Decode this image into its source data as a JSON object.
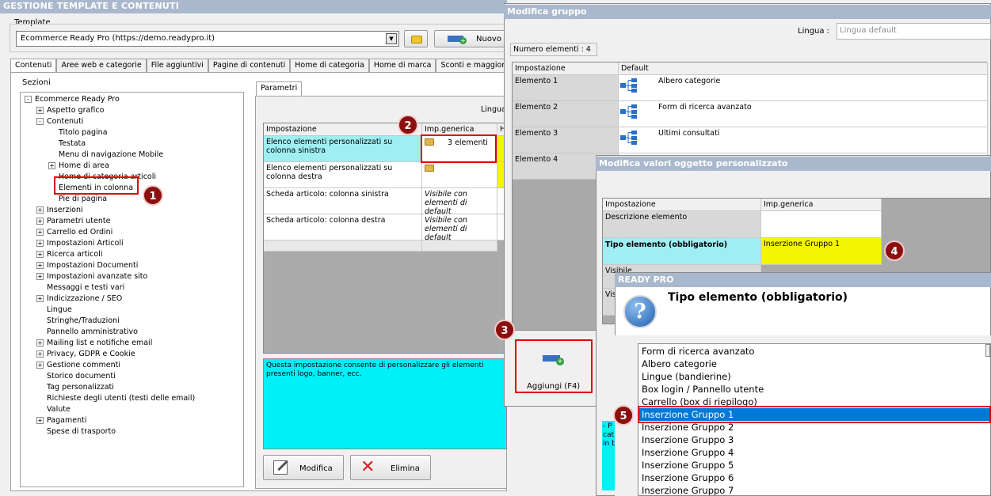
{
  "main": {
    "title": "GESTIONE TEMPLATE E CONTENUTI",
    "template_label": "Template",
    "template_value": "Ecommerce Ready Pro (https://demo.readypro.it)",
    "nuovo_label": "Nuovo",
    "tabs": [
      "Contenuti",
      "Aree web e categorie",
      "File aggiuntivi",
      "Pagine di contenuti",
      "Home di categoria",
      "Home di marca",
      "Sconti e maggiorazio"
    ],
    "sezioni_label": "Sezioni",
    "tree": {
      "root": "Ecommerce Ready Pro",
      "items": [
        {
          "label": "Aspetto grafico",
          "level": 1,
          "toggle": "+"
        },
        {
          "label": "Contenuti",
          "level": 1,
          "toggle": "-"
        },
        {
          "label": "Titolo pagina",
          "level": 2,
          "toggle": ""
        },
        {
          "label": "Testata",
          "level": 2,
          "toggle": ""
        },
        {
          "label": "Menu di navigazione Mobile",
          "level": 2,
          "toggle": ""
        },
        {
          "label": "Home di area",
          "level": 2,
          "toggle": "+"
        },
        {
          "label": "Home di categoria articoli",
          "level": 2,
          "toggle": ""
        },
        {
          "label": "Elementi in colonna",
          "level": 2,
          "toggle": ""
        },
        {
          "label": "Pie di pagina",
          "level": 2,
          "toggle": ""
        },
        {
          "label": "Inserzioni",
          "level": 1,
          "toggle": "+"
        },
        {
          "label": "Parametri utente",
          "level": 1,
          "toggle": "+"
        },
        {
          "label": "Carrello ed Ordini",
          "level": 1,
          "toggle": "+"
        },
        {
          "label": "Impostazioni Articoli",
          "level": 1,
          "toggle": "+"
        },
        {
          "label": "Ricerca articoli",
          "level": 1,
          "toggle": "+"
        },
        {
          "label": "Impostazioni Documenti",
          "level": 1,
          "toggle": "+"
        },
        {
          "label": "Impostazioni avanzate sito",
          "level": 1,
          "toggle": "+"
        },
        {
          "label": "Messaggi e testi vari",
          "level": 1,
          "toggle": ""
        },
        {
          "label": "Indicizzazione / SEO",
          "level": 1,
          "toggle": "+"
        },
        {
          "label": "Lingue",
          "level": 1,
          "toggle": ""
        },
        {
          "label": "Stringhe/Traduzioni",
          "level": 1,
          "toggle": ""
        },
        {
          "label": "Pannello amministrativo",
          "level": 1,
          "toggle": ""
        },
        {
          "label": "Mailing list e notifiche email",
          "level": 1,
          "toggle": "+"
        },
        {
          "label": "Privacy, GDPR e Cookie",
          "level": 1,
          "toggle": "+"
        },
        {
          "label": "Gestione commenti",
          "level": 1,
          "toggle": "+"
        },
        {
          "label": "Storico documenti",
          "level": 1,
          "toggle": ""
        },
        {
          "label": "Tag personalizzati",
          "level": 1,
          "toggle": ""
        },
        {
          "label": "Richieste degli utenti (testi delle email)",
          "level": 1,
          "toggle": ""
        },
        {
          "label": "Valute",
          "level": 1,
          "toggle": ""
        },
        {
          "label": "Pagamenti",
          "level": 1,
          "toggle": "+"
        },
        {
          "label": "Spese di trasporto",
          "level": 1,
          "toggle": ""
        }
      ]
    },
    "parametri_tab": "Parametri",
    "lingua_label": "Lingua",
    "grid_headers": [
      "Impostazione",
      "Imp.generica",
      "H"
    ],
    "grid_rows": [
      {
        "label": "Elenco elementi personalizzati su colonna sinistra",
        "value": "3 elementi"
      },
      {
        "label": "Elenco elementi personalizzati su colonna destra",
        "value": ""
      },
      {
        "label": "Scheda articolo: colonna sinistra",
        "value": "Visibile con elementi di default"
      },
      {
        "label": "Scheda articolo: colonna destra",
        "value": "Visibile con elementi di default"
      }
    ],
    "description": "Questa impostazione consente di personalizzare gli elementi presenti logo, banner, ecc.",
    "modifica_label": "Modifica",
    "elimina_label": "Elimina"
  },
  "gruppo": {
    "title": "Modifica gruppo",
    "lingua_label": "Lingua :",
    "lingua_placeholder": "Lingua default",
    "numero_elementi": "Numero elementi : 4",
    "headers": [
      "Impostazione",
      "Default"
    ],
    "rows": [
      {
        "label": "Elemento 1",
        "value": "Albero categorie"
      },
      {
        "label": "Elemento 2",
        "value": "Form di ricerca avanzato"
      },
      {
        "label": "Elemento 3",
        "value": "Ultimi consultati"
      },
      {
        "label": "Elemento 4",
        "value": ""
      }
    ],
    "aggiungi_label": "Aggiungi (F4)"
  },
  "oggetto": {
    "title": "Modifica valori oggetto personalizzato",
    "headers": [
      "Impostazione",
      "Imp.generica"
    ],
    "rows": [
      {
        "label": "Descrizione elemento",
        "value": ""
      },
      {
        "label": "Tipo elemento (obbligatorio)",
        "value": "Inserzione Gruppo 1"
      },
      {
        "label": "Visibile",
        "value": ""
      },
      {
        "label": "Vis",
        "value": ""
      }
    ],
    "note_fragments": [
      "- P",
      "cat",
      "in b"
    ]
  },
  "readypro": {
    "title": "READY PRO",
    "question": "Tipo elemento (obbligatorio)",
    "options": [
      "Form di ricerca avanzato",
      "Albero categorie",
      "Lingue (bandierine)",
      "Box login / Pannello utente",
      "Carrello (box di riepilogo)",
      "Inserzione Gruppo 1",
      "Inserzione Gruppo 2",
      "Inserzione Gruppo 3",
      "Inserzione Gruppo 4",
      "Inserzione Gruppo 5",
      "Inserzione Gruppo 6",
      "Inserzione Gruppo 7"
    ],
    "selected": "Inserzione Gruppo 1"
  },
  "badges": [
    "1",
    "2",
    "3",
    "4",
    "5"
  ],
  "colors": {
    "title_bar": "#a9b8cc",
    "highlight_cyan": "#9eeef2",
    "highlight_yellow": "#f5f500",
    "annotation_red": "#e00000",
    "badge": "#8b0f0f",
    "selection": "#0078d7"
  }
}
